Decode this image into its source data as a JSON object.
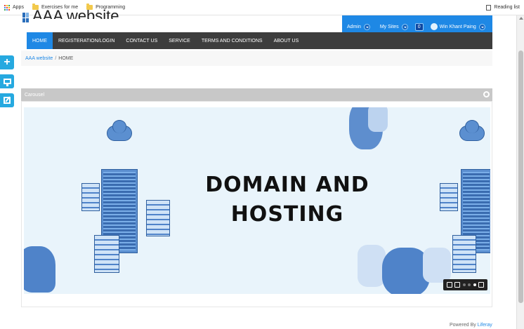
{
  "browser": {
    "apps_label": "Apps",
    "bookmarks": [
      {
        "label": "Exercises for me"
      },
      {
        "label": "Programming"
      }
    ],
    "reading_list_label": "Reading list"
  },
  "site": {
    "title": "AAA website"
  },
  "dockbar": {
    "admin_label": "Admin",
    "my_sites_label": "My Sites",
    "notification_count": "0",
    "user_name": "Win Khant Paing"
  },
  "nav": {
    "items": [
      {
        "label": "HOME",
        "active": true
      },
      {
        "label": "REGISTERATION/LOGIN",
        "active": false
      },
      {
        "label": "CONTACT US",
        "active": false
      },
      {
        "label": "SERVICE",
        "active": false
      },
      {
        "label": "TERMS AND CONDITIONS",
        "active": false
      },
      {
        "label": "ABOUT US",
        "active": false
      }
    ]
  },
  "breadcrumb": {
    "root": "AAA website",
    "separator": "/",
    "current": "HOME"
  },
  "carousel": {
    "portlet_title": "Carousel",
    "slide_title_line1": "DOMAIN AND",
    "slide_title_line2": "HOSTING",
    "slide_count": 3,
    "active_slide": 3
  },
  "footer": {
    "powered_by": "Powered By",
    "liferay": "Liferay"
  },
  "colors": {
    "accent": "#1e88e5",
    "nav_bg": "#3d3d3d",
    "side_dock": "#26a9e0"
  }
}
